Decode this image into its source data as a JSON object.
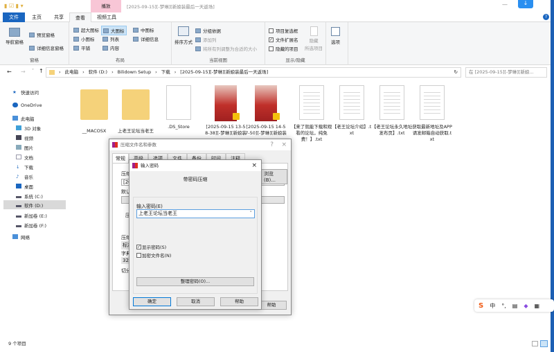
{
  "window": {
    "title": "[2025-09-15][-梦琳][新娘装最后一天返场]",
    "context_tab": "播放"
  },
  "tabs": [
    "文件",
    "主页",
    "共享",
    "查看",
    "视频工具"
  ],
  "ribbon": {
    "panes": {
      "nav_pane": "导航窗格",
      "preview": "预览窗格",
      "details": "详细信息窗格",
      "label": "窗格"
    },
    "layout": {
      "items": [
        "超大图标",
        "大图标",
        "中图标",
        "小图标",
        "列表",
        "详细信息",
        "平铺",
        "内容"
      ],
      "label": "布局"
    },
    "view": {
      "sort": "排序方式",
      "group": "分组依据",
      "add_col": "添加列",
      "fit": "将所有列调整为合适的大小",
      "label": "当前视图"
    },
    "show": {
      "checkboxes": "项目复选框",
      "extensions": "文件扩展名",
      "hidden": "隐藏的项目",
      "hide_sel": "隐藏",
      "hide_sel2": "所选项目",
      "label": "显示/隐藏"
    },
    "options": "选项"
  },
  "address": {
    "path": [
      "此电脑",
      "软件 (D:)",
      "Bilidown Setup",
      "下载",
      "[2025-09-15][-梦琳][新娘装最后一天返场]"
    ],
    "search_placeholder": "在 [2025-09-15][-梦琳][新娘..."
  },
  "nav": [
    "快速访问",
    "OneDrive",
    "此电脑",
    "3D 对象",
    "视频",
    "图片",
    "文档",
    "下载",
    "音乐",
    "桌面",
    "系统 (C:)",
    "软件 (D:)",
    "新加卷 (E:)",
    "新加卷 (F:)",
    "网络"
  ],
  "files": [
    {
      "name": "__MACOSX",
      "type": "folder"
    },
    {
      "name": "上老王论坛当老王",
      "type": "folder"
    },
    {
      "name": ".DS_Store",
      "type": "file"
    },
    {
      "name": "[2025-09-15 13-58-38][-梦琳][新娘装最后...",
      "type": "video"
    },
    {
      "name": "[2025-09-15 14-57-50][-梦琳][新娘装最后...",
      "type": "video"
    },
    {
      "name": "【来了就能下载和观看的论坛，纯免费！】.txt",
      "type": "txt"
    },
    {
      "name": "【老王论坛介绍】.txt",
      "type": "txt"
    },
    {
      "name": "【老王论坛永久地址发布页】.txt",
      "type": "txt"
    },
    {
      "name": "获取最新地址及APP请发邮箱自动获取.txt",
      "type": "txt"
    }
  ],
  "status": "9 个项目",
  "archive_dialog": {
    "title": "压缩文件名和参数",
    "tabs": [
      "常规",
      "高级",
      "选项",
      "文件",
      "备份",
      "时间",
      "注释"
    ],
    "browse": "浏览(B)...",
    "help": "帮助",
    "labels": [
      "压缩",
      "[20",
      "默认",
      "压",
      "压缩",
      "标准",
      "字典",
      "32 M",
      "切分"
    ]
  },
  "password_dialog": {
    "title": "输入密码",
    "heading": "带密码压缩",
    "field_label": "输入密码(E)",
    "password": "上老王论坛当老王",
    "show_password": "显示密码(S)",
    "encrypt_names": "加密文件名(N)",
    "organize": "整理密码(O)...",
    "ok": "确定",
    "cancel": "取消",
    "help": "帮助"
  },
  "ime": {
    "logo": "S",
    "mode": "中"
  }
}
